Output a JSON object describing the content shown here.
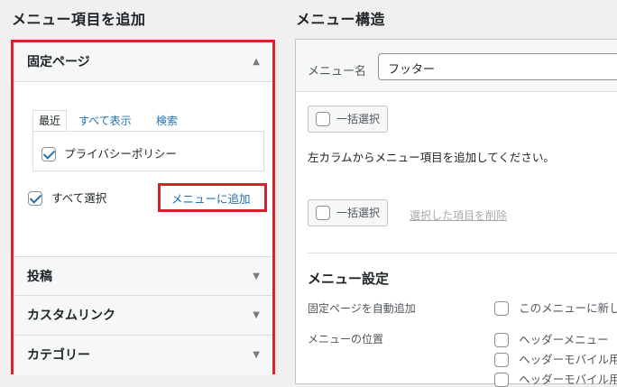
{
  "left": {
    "title": "メニュー項目を追加",
    "pages_section": {
      "title": "固定ページ",
      "tabs": [
        "最近",
        "すべて表示",
        "検索"
      ],
      "items": [
        {
          "label": "プライバシーポリシー",
          "checked": true
        }
      ],
      "select_all": {
        "label": "すべて選択",
        "checked": true
      },
      "add_button": "メニューに追加"
    },
    "sections": [
      "投稿",
      "カスタムリンク",
      "カテゴリー"
    ]
  },
  "right": {
    "title": "メニュー構造",
    "menu_name_label": "メニュー名",
    "menu_name_value": "フッター",
    "bulk_select": "一括選択",
    "instruction": "左カラムからメニュー項目を追加してください。",
    "delete_selected": "選択した項目を削除",
    "settings": {
      "title": "メニュー設定",
      "auto_add_label": "固定ページを自動追加",
      "auto_add_option": "このメニューに新し",
      "location_label": "メニューの位置",
      "locations": [
        "ヘッダーメニュー",
        "ヘッダーモバイル用",
        "ヘッダーモバイル用"
      ]
    }
  },
  "colors": {
    "highlight": "#d6232b",
    "link": "#2271b1",
    "background": "#f0f0f1"
  }
}
